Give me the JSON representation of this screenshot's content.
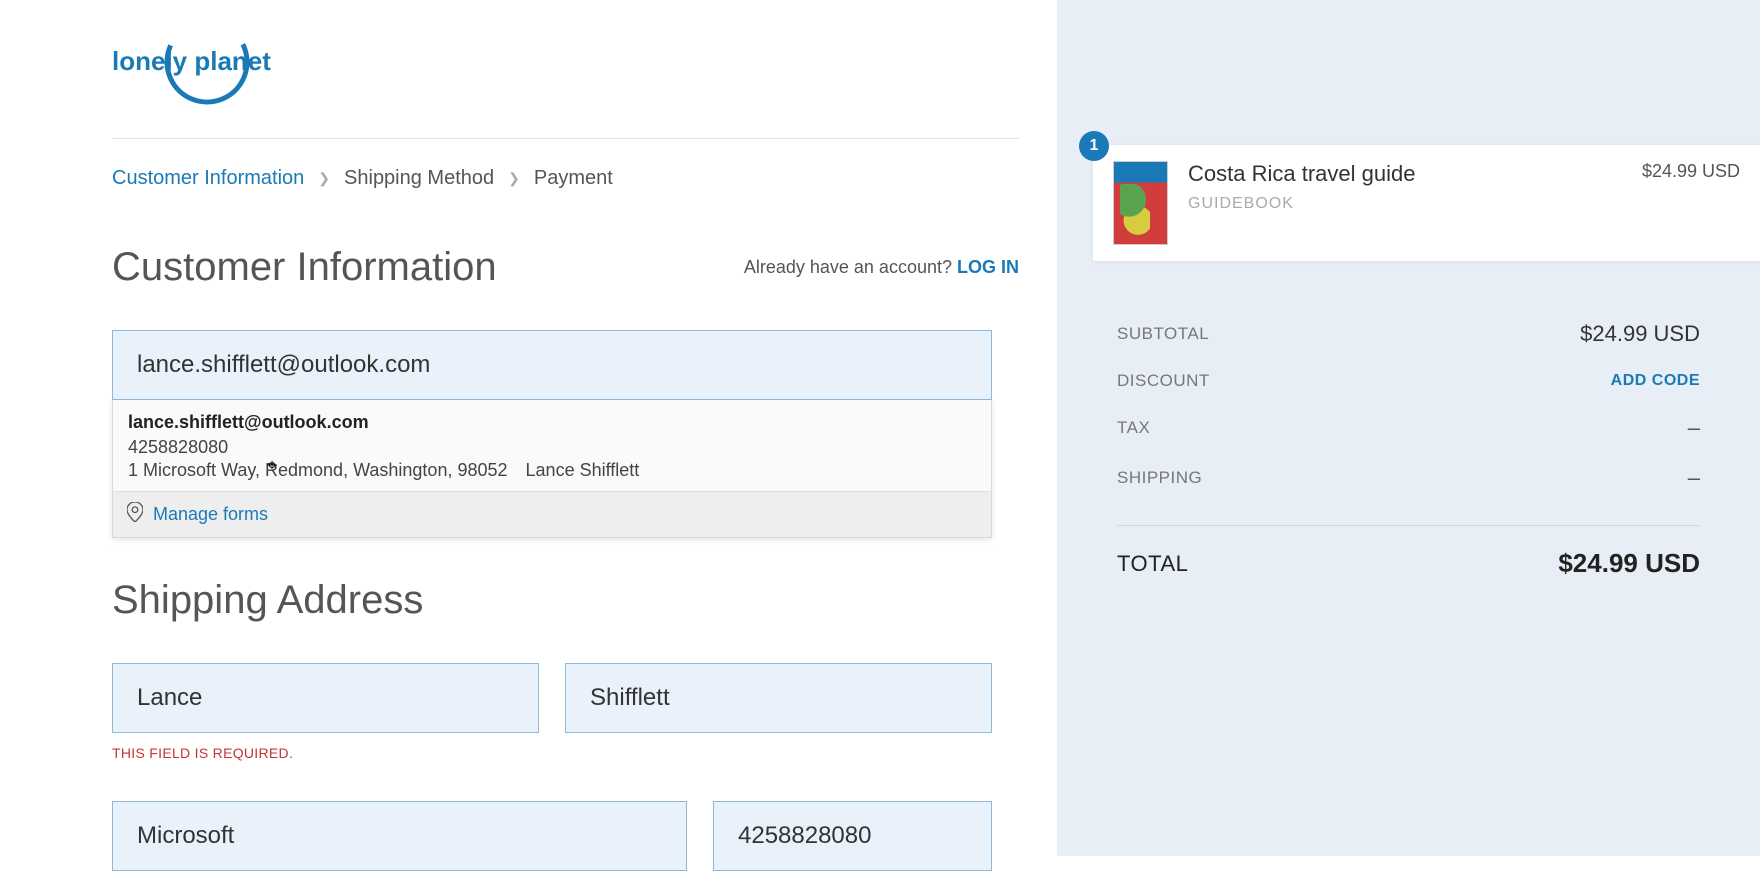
{
  "brand": {
    "name": "lonely planet"
  },
  "breadcrumb": {
    "step1": "Customer Information",
    "step2": "Shipping Method",
    "step3": "Payment"
  },
  "customer_info": {
    "heading": "Customer Information",
    "already_prompt": "Already have an account? ",
    "login_label": "LOG IN",
    "email_value": "lance.shifflett@outlook.com"
  },
  "autofill": {
    "email": "lance.shifflett@outlook.com",
    "phone": "4258828080",
    "address_line": "1 Microsoft Way, Redmond, Washington, 98052",
    "name": "Lance Shifflett",
    "manage_label": "Manage forms"
  },
  "shipping": {
    "heading": "Shipping Address",
    "first_name": "Lance",
    "last_name": "Shifflett",
    "required_error": "THIS FIELD IS REQUIRED.",
    "company": "Microsoft",
    "phone": "4258828080"
  },
  "cart": {
    "qty": "1",
    "item_title": "Costa Rica travel guide",
    "item_sub": "GUIDEBOOK",
    "item_price": "$24.99 USD"
  },
  "summary": {
    "subtotal_label": "SUBTOTAL",
    "subtotal_value": "$24.99 USD",
    "discount_label": "DISCOUNT",
    "add_code_label": "ADD CODE",
    "tax_label": "TAX",
    "tax_value": "–",
    "shipping_label": "SHIPPING",
    "shipping_value": "–",
    "total_label": "TOTAL",
    "total_value": "$24.99 USD"
  }
}
